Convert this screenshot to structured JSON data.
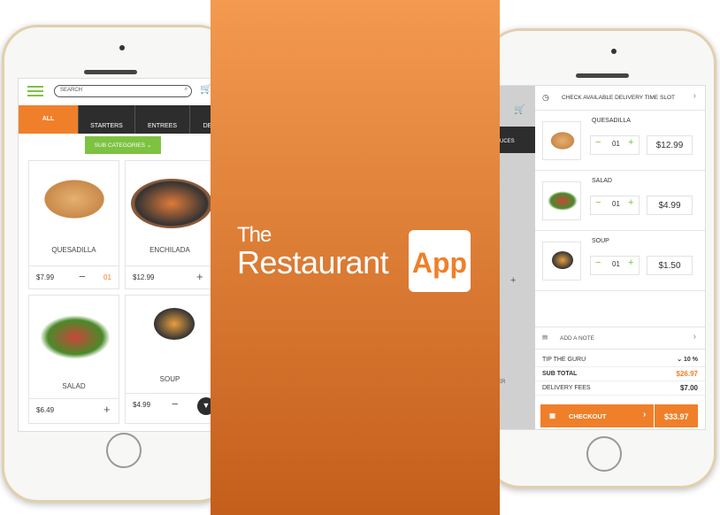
{
  "brand": {
    "line1": "The",
    "line2": "Restaurant",
    "badge": "App",
    "accent": "#f07f2a",
    "green": "#7dc241"
  },
  "left": {
    "search_placeholder": "SEARCH",
    "tabs": [
      "ALL",
      "STARTERS",
      "ENTREES",
      "DE"
    ],
    "subcategories": "SUB CATEGORIES",
    "items": [
      {
        "name": "QUESADILLA",
        "price": "$7.99",
        "qty": "01"
      },
      {
        "name": "ENCHILADA",
        "price": "$12.99"
      },
      {
        "name": "SALAD",
        "price": "$6.49"
      },
      {
        "name": "SOUP",
        "price": "$4.99"
      }
    ]
  },
  "right": {
    "delivery": "CHECK AVAILABLE DELIVERY TIME SLOT",
    "behind_tab": "UCES",
    "behind_text": "ER",
    "cart": [
      {
        "name": "QUESADILLA",
        "qty": "01",
        "price": "$12.99"
      },
      {
        "name": "SALAD",
        "qty": "01",
        "price": "$4.99"
      },
      {
        "name": "SOUP",
        "qty": "01",
        "price": "$1.50"
      }
    ],
    "note": "ADD A NOTE",
    "tip_label": "TIP THE GURU",
    "tip_value": "10 %",
    "subtotal_label": "SUB TOTAL",
    "subtotal": "$26.97",
    "fees_label": "DELIVERY FEES",
    "fees": "$7.00",
    "checkout": "CHECKOUT",
    "total": "$33.97"
  }
}
